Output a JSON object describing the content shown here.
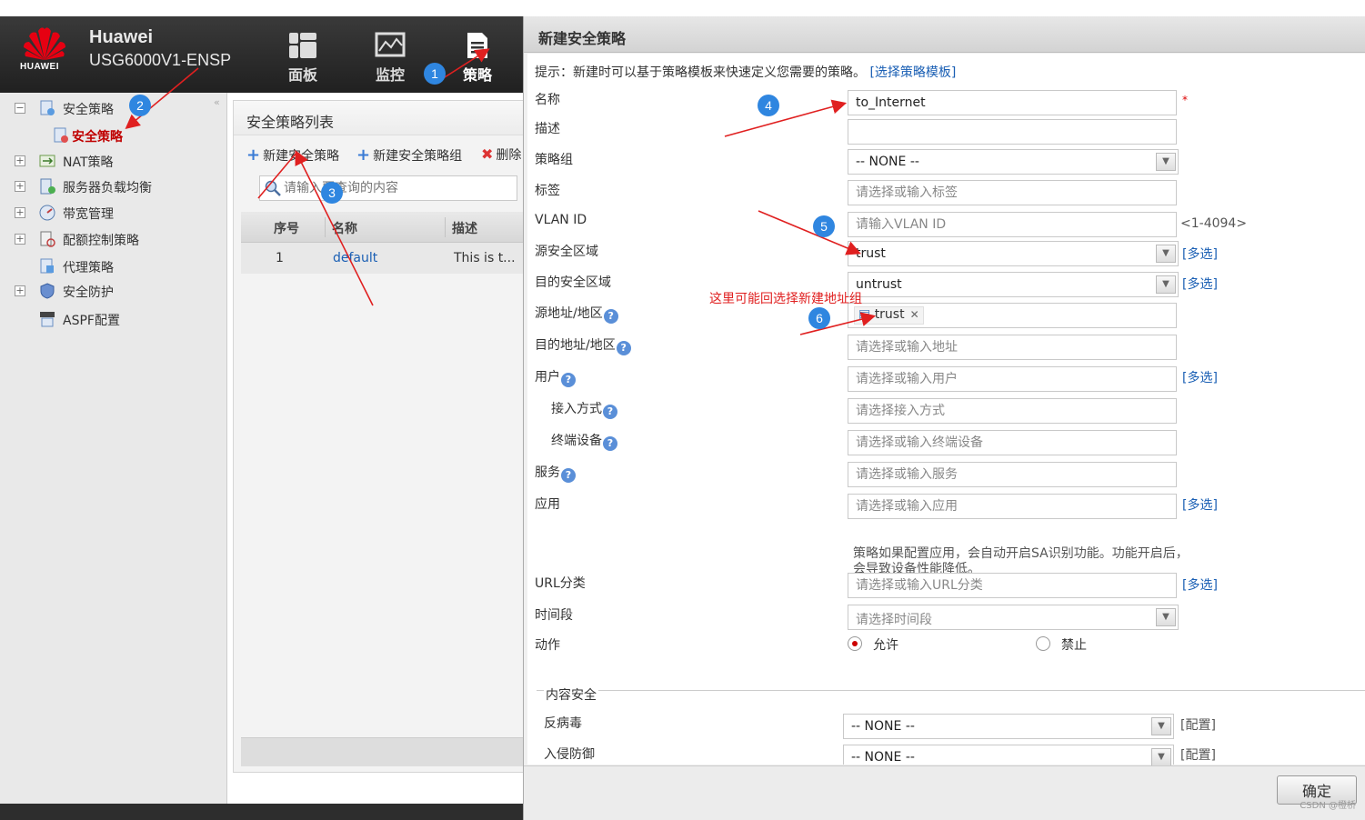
{
  "brand": {
    "company": "Huawei",
    "model": "USG6000V1-ENSP",
    "logo_text": "HUAWEI"
  },
  "nav": [
    {
      "label": "面板",
      "icon": "dashboard-icon"
    },
    {
      "label": "监控",
      "icon": "monitor-icon"
    },
    {
      "label": "策略",
      "icon": "policy-icon"
    }
  ],
  "sidebar": {
    "items": [
      {
        "label": "安全策略",
        "expanded": true
      },
      {
        "label": "安全策略",
        "selected": true
      },
      {
        "label": "NAT策略"
      },
      {
        "label": "服务器负载均衡"
      },
      {
        "label": "带宽管理"
      },
      {
        "label": "配额控制策略"
      },
      {
        "label": "代理策略"
      },
      {
        "label": "安全防护"
      },
      {
        "label": "ASPF配置"
      }
    ]
  },
  "policy_list": {
    "title": "安全策略列表",
    "toolbar": {
      "new_policy": "新建安全策略",
      "new_group": "新建安全策略组",
      "delete": "删除"
    },
    "search_placeholder": "请输入要查询的内容",
    "columns": [
      "序号",
      "名称",
      "描述"
    ],
    "rows": [
      {
        "index": "1",
        "name": "default",
        "desc": "This is t..."
      }
    ]
  },
  "dialog": {
    "title": "新建安全策略",
    "hint_prefix": "提示：新建时可以基于策略模板来快速定义您需要的策略。",
    "hint_link": "[选择策略模板]",
    "labels": {
      "name": "名称",
      "desc": "描述",
      "group": "策略组",
      "tag": "标签",
      "vlan": "VLAN ID",
      "src_zone": "源安全区域",
      "dst_zone": "目的安全区域",
      "src_addr": "源地址/地区",
      "dst_addr": "目的地址/地区",
      "user": "用户",
      "access": "接入方式",
      "terminal": "终端设备",
      "service": "服务",
      "app": "应用",
      "url": "URL分类",
      "time": "时间段",
      "action": "动作",
      "content_security": "内容安全",
      "antivirus": "反病毒",
      "ips": "入侵防御"
    },
    "values": {
      "name": "to_Internet",
      "group": "-- NONE --",
      "src_zone": "trust",
      "dst_zone": "untrust",
      "src_addr_tag": "trust",
      "antivirus": "-- NONE --",
      "ips": "-- NONE --"
    },
    "placeholders": {
      "tag": "请选择或输入标签",
      "vlan": "请输入VLAN ID",
      "dst_addr": "请选择或输入地址",
      "user": "请选择或输入用户",
      "access": "请选择接入方式",
      "terminal": "请选择或输入终端设备",
      "service": "请选择或输入服务",
      "app": "请选择或输入应用",
      "url": "请选择或输入URL分类",
      "time": "请选择时间段"
    },
    "required_mark": "*",
    "vlan_range": "<1-4094>",
    "multi_select": "[多选]",
    "configure": "[配置]",
    "app_note": "策略如果配置应用，会自动开启SA识别功能。功能开启后，会导致设备性能降低。",
    "action_allow": "允许",
    "action_deny": "禁止",
    "ok": "确定"
  },
  "annotations": {
    "badges": [
      "1",
      "2",
      "3",
      "4",
      "5",
      "6"
    ],
    "note": "这里可能回选择新建地址组",
    "color": "#e02020"
  },
  "watermark": "CSDN @橙桥"
}
